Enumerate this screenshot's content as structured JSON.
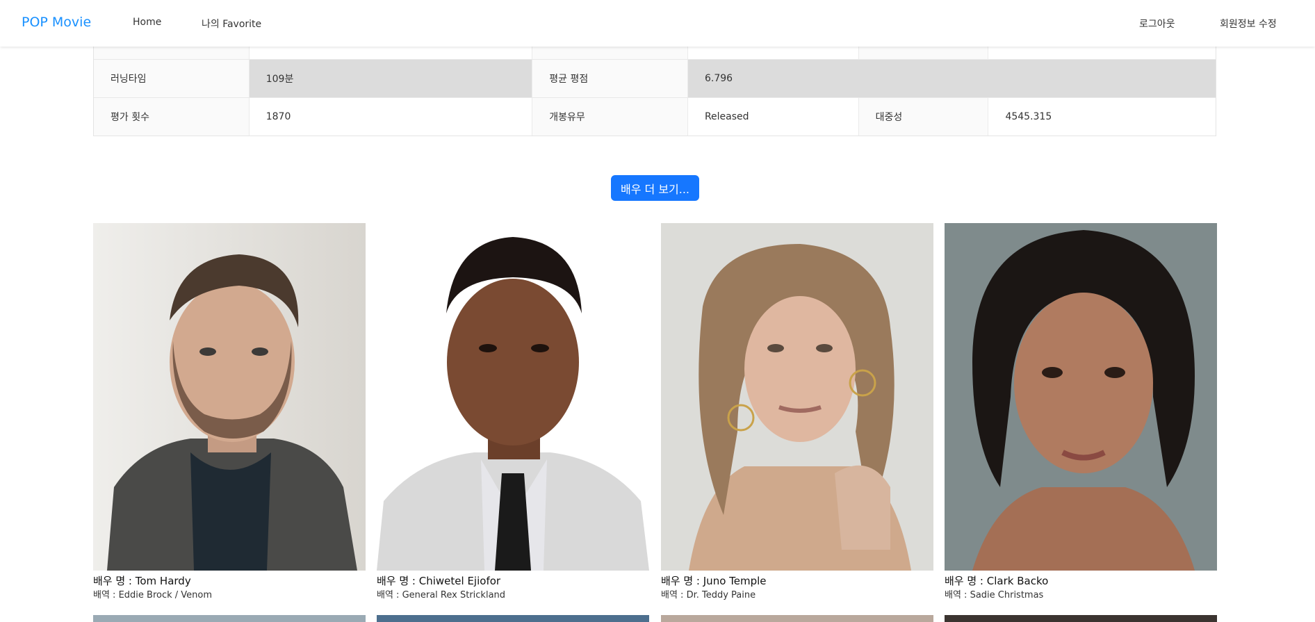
{
  "navbar": {
    "brand": "POP Movie",
    "links": [
      "Home",
      "나의 Favorite"
    ],
    "right_links": [
      "로그아웃",
      "회원정보 수정"
    ],
    "brand_color": "#1890ff"
  },
  "details": {
    "row1": {
      "label_runtime": "러닝타임",
      "runtime": "109분",
      "label_avg": "평균 평점",
      "avg": "6.796"
    },
    "row2": {
      "label_votes": "평가 횟수",
      "votes": "1870",
      "label_status": "개봉유무",
      "status": "Released",
      "label_popularity": "대중성",
      "popularity": "4545.315"
    }
  },
  "more_button": {
    "label": "배우 더 보기...",
    "color": "#1677ff"
  },
  "actors": [
    {
      "name": "배우 명 : Tom Hardy",
      "role": "배역 : Eddie Brock / Venom"
    },
    {
      "name": "배우 명 : Chiwetel Ejiofor",
      "role": "배역 : General Rex Strickland"
    },
    {
      "name": "배우 명 : Juno Temple",
      "role": "배역 : Dr. Teddy Paine"
    },
    {
      "name": "배우 명 : Clark Backo",
      "role": "배역 : Sadie Christmas"
    }
  ]
}
